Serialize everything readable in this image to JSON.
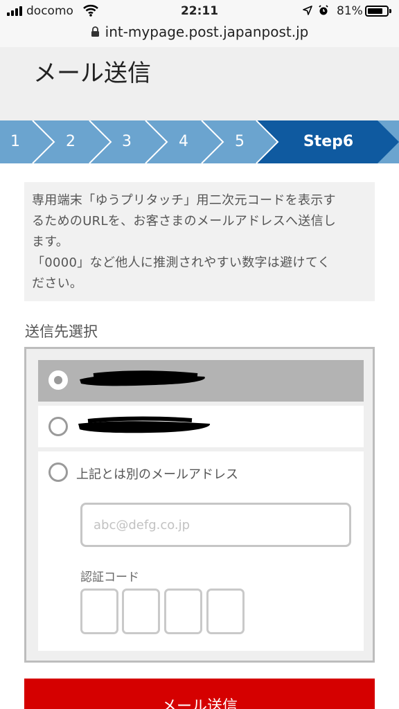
{
  "status_bar": {
    "carrier": "docomo",
    "time": "22:11",
    "battery_percent": "81%",
    "battery_level": 0.81,
    "icons": [
      "signal-icon",
      "wifi-icon",
      "location-icon",
      "alarm-icon",
      "battery-icon"
    ]
  },
  "browser": {
    "url": "int-mypage.post.japanpost.jp"
  },
  "header": {
    "title": "メール送信"
  },
  "steps": {
    "items": [
      "1",
      "2",
      "3",
      "4",
      "5",
      "Step6"
    ],
    "active_index": 5,
    "colors": {
      "inactive": "#6ba4cf",
      "active": "#0f5aa0"
    }
  },
  "notice": {
    "line1": "専用端末「ゆうプリタッチ」用二次元コードを表示す",
    "line2": "るためのURLを、お客さまのメールアドレスへ送信し",
    "line3": "ます。",
    "line4": "「0000」など他人に推測されやすい数字は避けてく",
    "line5": "ださい。"
  },
  "destination": {
    "label": "送信先選択",
    "options": [
      {
        "text": "",
        "redacted": true,
        "selected": true
      },
      {
        "text": "",
        "redacted": true,
        "selected": false
      },
      {
        "text": "上記とは別のメールアドレス",
        "redacted": false,
        "selected": false
      }
    ],
    "email_placeholder": "abc@defg.co.jp",
    "email_value": "",
    "code_label": "認証コード",
    "code_digits": [
      "",
      "",
      "",
      ""
    ]
  },
  "send_button": {
    "label": "メール送信",
    "color": "#d50000"
  }
}
